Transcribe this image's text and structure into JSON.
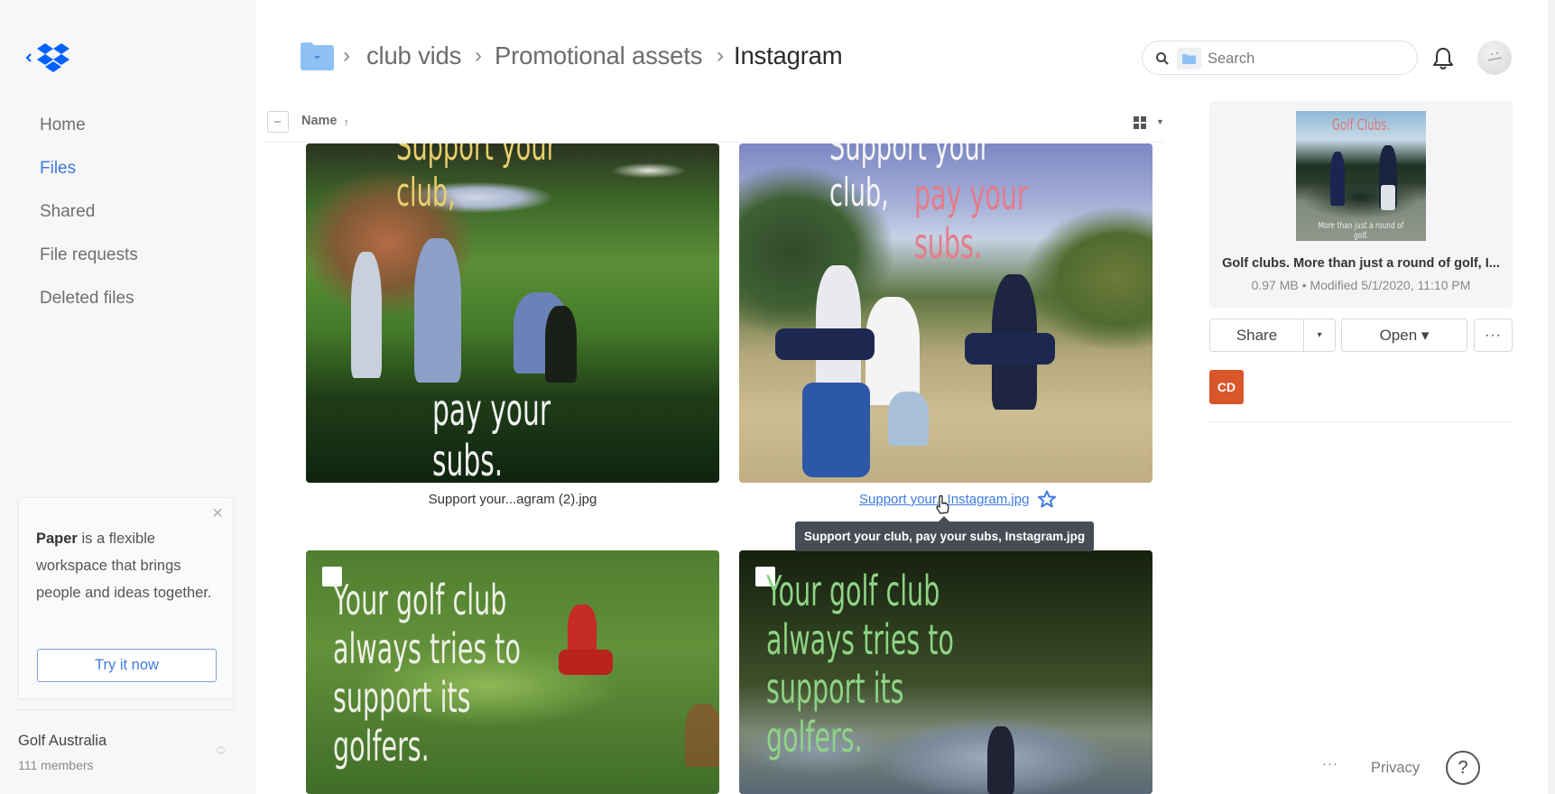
{
  "sidebar": {
    "logo": "dropbox-logo",
    "back_icon": "chevron-left-icon",
    "nav": [
      {
        "label": "Home",
        "active": false
      },
      {
        "label": "Files",
        "active": true
      },
      {
        "label": "Shared",
        "active": false
      },
      {
        "label": "File requests",
        "active": false
      },
      {
        "label": "Deleted files",
        "active": false
      }
    ],
    "promo": {
      "bold": "Paper",
      "text": " is a flexible workspace that brings people and ideas together.",
      "button": "Try it now",
      "close_icon": "close-icon"
    },
    "team": {
      "name": "Golf Australia",
      "members": "111 members"
    }
  },
  "header": {
    "breadcrumb": [
      {
        "label": "club vids"
      },
      {
        "label": "Promotional assets"
      },
      {
        "label": "Instagram",
        "current": true
      }
    ],
    "separator": "›",
    "search": {
      "placeholder": "Search",
      "value": ""
    },
    "icons": {
      "search": "search-icon",
      "bell": "bell-icon",
      "avatar": "avatar"
    }
  },
  "list": {
    "column_name": "Name",
    "sort_indicator": "↑",
    "view_mode": "grid"
  },
  "files": [
    {
      "caption": "Support your...agram (2).jpg",
      "overlay_top": "Support your club,",
      "overlay_bottom": "pay your subs."
    },
    {
      "caption": "Support your...Instagram.jpg",
      "overlay_top": "Support your club,",
      "overlay_bottom": "pay your subs.",
      "hovered": true,
      "starred": false
    },
    {
      "caption": "",
      "overlay_lines": [
        "Your golf club",
        "always tries to",
        "support its golfers."
      ]
    },
    {
      "caption": "",
      "overlay_lines": [
        "Your golf club always tries to",
        "support its golfers."
      ]
    }
  ],
  "tooltip": "Support your club, pay your subs, Instagram.jpg",
  "preview": {
    "thumb_title": "Golf Clubs.",
    "thumb_subtitle": "More than just a round of golf.",
    "name": "Golf clubs. More than just a round of golf, I...",
    "meta": "0.97 MB • Modified 5/1/2020, 11:10 PM",
    "buttons": {
      "share": "Share",
      "share_caret": "▾",
      "open": "Open ▾",
      "more": "···"
    },
    "member_initials": "CD",
    "member_color": "#d9562b"
  },
  "footer": {
    "more": "···",
    "privacy": "Privacy",
    "help": "?"
  },
  "colors": {
    "accent": "#3d7be0",
    "dropbox_blue": "#0061fe",
    "folder_blue": "#8ec1f5",
    "tooltip_bg": "#484c54"
  }
}
